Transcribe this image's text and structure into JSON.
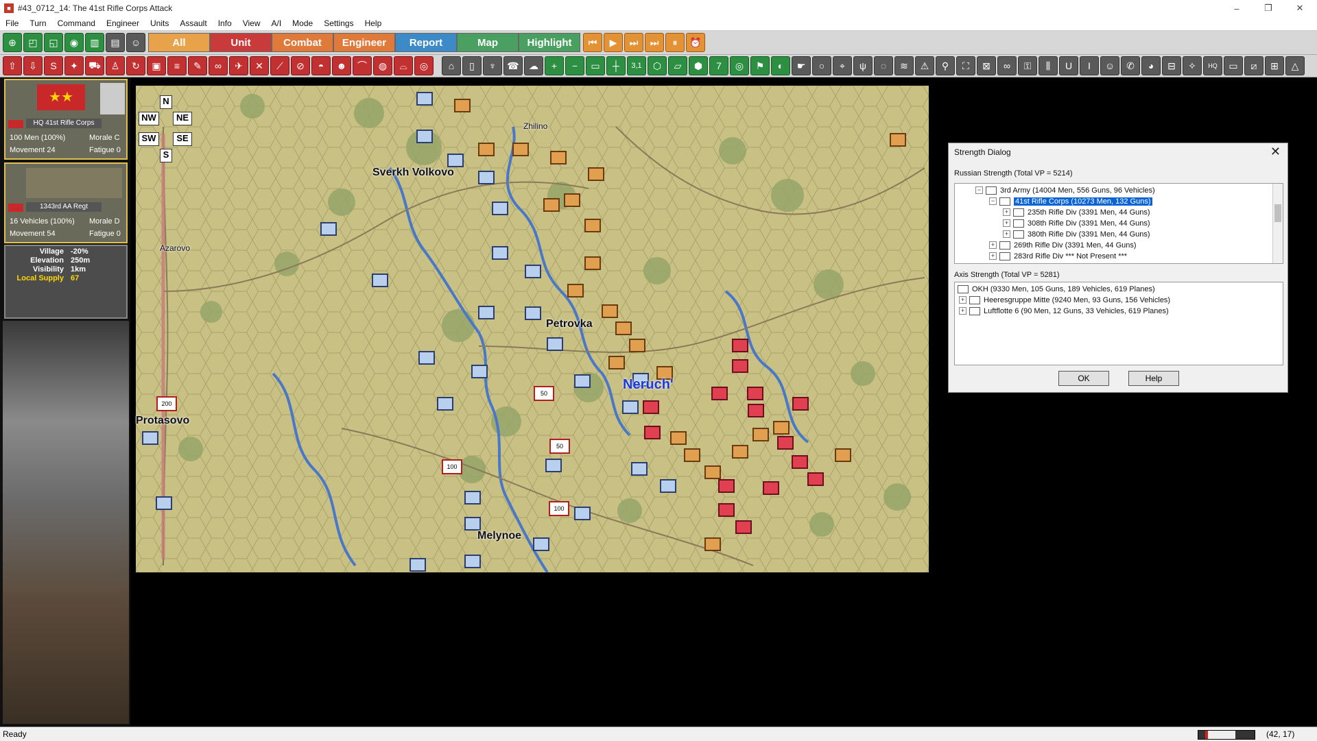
{
  "window": {
    "title": "#43_0712_14: The 41st Rifle Corps Attack",
    "minimize": "–",
    "maximize": "❐",
    "close": "✕"
  },
  "menu": [
    "File",
    "Turn",
    "Command",
    "Engineer",
    "Units",
    "Assault",
    "Info",
    "View",
    "A/I",
    "Mode",
    "Settings",
    "Help"
  ],
  "filters": {
    "all": "All",
    "unit": "Unit",
    "combat": "Combat",
    "engineer": "Engineer",
    "report": "Report",
    "map": "Map",
    "highlight": "Highlight"
  },
  "toolbar2_numbers": {
    "range": "3,1",
    "seven": "7"
  },
  "units": [
    {
      "name": "HQ 41st Rifle Corps",
      "strength": "100 Men (100%)",
      "morale": "Morale C",
      "movement": "Movement 24",
      "fatigue": "Fatigue 0"
    },
    {
      "name": "1343rd AA Regt",
      "strength": "16 Vehicles (100%)",
      "morale": "Morale D",
      "movement": "Movement 54",
      "fatigue": "Fatigue 0"
    }
  ],
  "terrain": [
    {
      "k": "Village",
      "v": "-20%"
    },
    {
      "k": "Elevation",
      "v": "250m"
    },
    {
      "k": "Visibility",
      "v": "1km"
    },
    {
      "k": "Local Supply",
      "v": "67"
    }
  ],
  "compass": {
    "n": "N",
    "ne": "NE",
    "nw": "NW",
    "sw": "SW",
    "se": "SE",
    "s": "S"
  },
  "places": {
    "sverkh": "Sverkh Volkovo",
    "zhilino": "Zhilino",
    "azarovo": "Azarovo",
    "petrovka": "Petrovka",
    "neruch": "Neruch'",
    "protasovo": "Protasovo",
    "melynoe": "Melynoe"
  },
  "map_badges": {
    "a": "200",
    "b": "50",
    "c": "50",
    "d": "100",
    "e": "100"
  },
  "dialog": {
    "title": "Strength Dialog",
    "russian_header": "Russian Strength (Total VP = 5214)",
    "russian_tree": [
      {
        "label": "3rd Army (14004 Men, 556 Guns, 96 Vehicles)",
        "exp": "−"
      },
      {
        "label": "41st Rifle Corps (10273 Men, 132 Guns)",
        "exp": "−"
      },
      {
        "label": "235th Rifle Div (3391 Men, 44 Guns)",
        "exp": "+"
      },
      {
        "label": "308th Rifle Div (3391 Men, 44 Guns)",
        "exp": "+"
      },
      {
        "label": "380th Rifle Div (3391 Men, 44 Guns)",
        "exp": "+"
      },
      {
        "label": "269th Rifle Div (3391 Men, 44 Guns)",
        "exp": "+"
      },
      {
        "label": "283rd Rifle Div *** Not Present ***",
        "exp": "+"
      }
    ],
    "axis_header": "Axis Strength (Total VP = 5281)",
    "axis_tree": [
      {
        "label": "OKH (9330 Men, 105 Guns, 189 Vehicles, 619 Planes)",
        "exp": ""
      },
      {
        "label": "Heeresgruppe Mitte (9240 Men, 93 Guns, 156 Vehicles)",
        "exp": "+"
      },
      {
        "label": "Luftflotte 6 (90 Men, 12 Guns, 33 Vehicles, 619 Planes)",
        "exp": "+"
      }
    ],
    "ok": "OK",
    "help": "Help"
  },
  "status": {
    "text": "Ready",
    "coords": "(42, 17)"
  },
  "colors": {
    "map_bg": "#c9c184",
    "river": "#4a78c8",
    "soviet": "#b8d0ee",
    "german_orange": "#e0a050",
    "german_red": "#e04050"
  }
}
